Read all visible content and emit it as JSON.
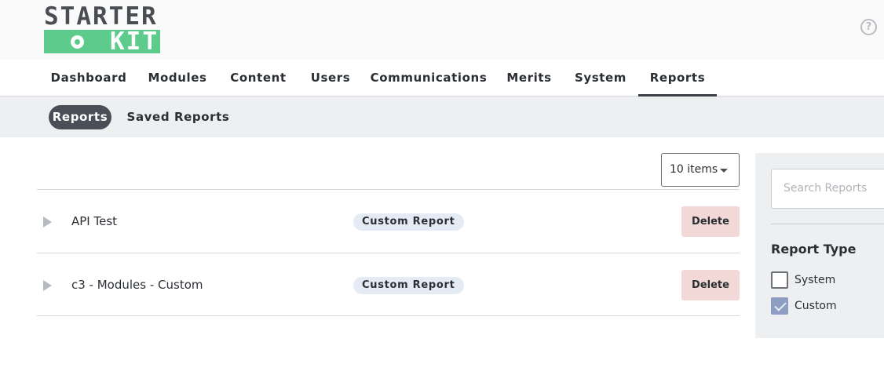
{
  "brand": {
    "logo_top": "STARTER",
    "logo_bottom": "KIT",
    "help_glyph": "?"
  },
  "nav": {
    "items": [
      {
        "label": "Dashboard"
      },
      {
        "label": "Modules"
      },
      {
        "label": "Content"
      },
      {
        "label": "Users"
      },
      {
        "label": "Communications"
      },
      {
        "label": "Merits"
      },
      {
        "label": "System"
      },
      {
        "label": "Reports"
      }
    ],
    "active": "Reports"
  },
  "subnav": {
    "items": [
      {
        "label": "Reports"
      },
      {
        "label": "Saved Reports"
      }
    ],
    "active": "Reports"
  },
  "pager": {
    "label": "10 items"
  },
  "reports": [
    {
      "name": "API Test",
      "type": "Custom Report",
      "delete_label": "Delete"
    },
    {
      "name": "c3 - Modules - Custom",
      "type": "Custom Report",
      "delete_label": "Delete"
    }
  ],
  "sidebar": {
    "search_placeholder": "Search Reports",
    "filter_title": "Report Type",
    "filters": [
      {
        "label": "System",
        "checked": false
      },
      {
        "label": "Custom",
        "checked": true
      }
    ]
  },
  "colors": {
    "brand_green": "#5ccb8b",
    "active_pill": "#4a4f57",
    "delete_bg": "#f2d9d7",
    "badge_bg": "#e4ebf5",
    "checkbox_checked": "#8d9ec2"
  }
}
